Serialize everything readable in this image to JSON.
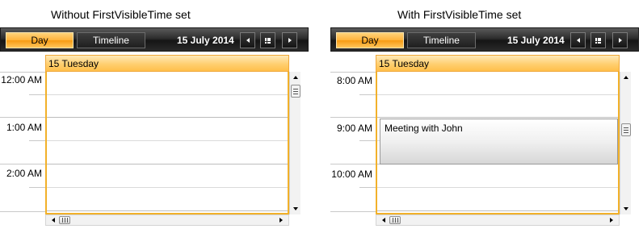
{
  "captions": {
    "left": "Without FirstVisibleTime set",
    "right": "With FirstVisibleTime set"
  },
  "left_panel": {
    "toolbar": {
      "day_tab": "Day",
      "timeline_tab": "Timeline",
      "date": "15 July 2014",
      "prev_icon": "chevron-left-icon",
      "today_icon": "calendar-grid-icon",
      "next_icon": "chevron-right-icon"
    },
    "day_header": "15 Tuesday",
    "times": [
      "12:00 AM",
      "1:00 AM",
      "2:00 AM"
    ]
  },
  "right_panel": {
    "toolbar": {
      "day_tab": "Day",
      "timeline_tab": "Timeline",
      "date": "15 July 2014",
      "prev_icon": "chevron-left-icon",
      "today_icon": "calendar-grid-icon",
      "next_icon": "chevron-right-icon"
    },
    "day_header": "15 Tuesday",
    "times": [
      "8:00 AM",
      "9:00 AM",
      "10:00 AM"
    ],
    "appointment": {
      "subject": "Meeting with John"
    }
  },
  "colors": {
    "accent": "#ffb23a",
    "column_border": "#f2b12a",
    "toolbar": "#1f1f1f"
  }
}
